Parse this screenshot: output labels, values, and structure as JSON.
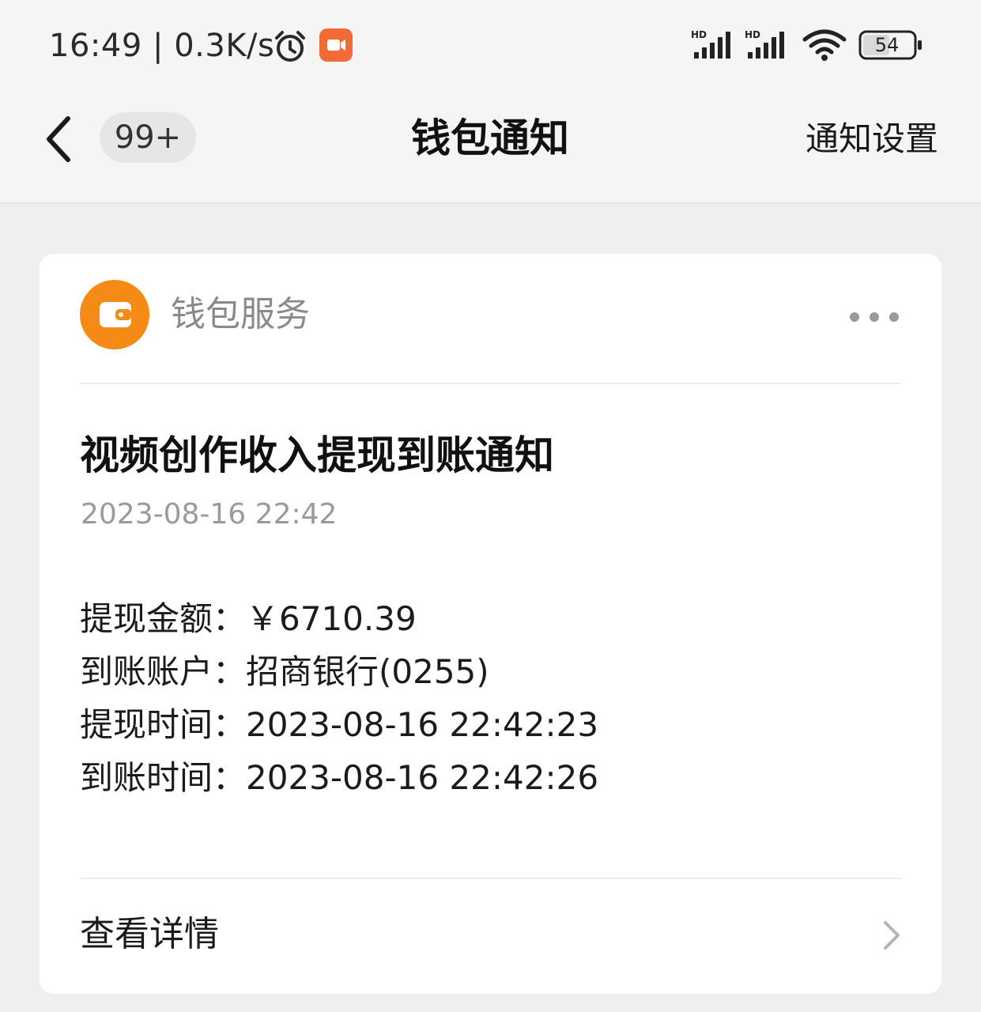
{
  "status_bar": {
    "time": "16:49",
    "separator": "|",
    "network_speed": "0.3K/s",
    "battery": "54",
    "icons": [
      "alarm-icon",
      "screen-record-icon",
      "signal-hd-icon",
      "signal-hd-icon",
      "wifi-icon",
      "battery-icon"
    ]
  },
  "header": {
    "back_icon": "chevron-left-icon",
    "badge_count": "99+",
    "title": "钱包通知",
    "settings_label": "通知设置"
  },
  "card": {
    "service_name": "钱包服务",
    "service_icon": "wallet-icon",
    "accent_color": "#f58a14",
    "more_icon": "more-horizontal-icon",
    "title": "视频创作收入提现到账通知",
    "date": "2023-08-16 22:42",
    "details": [
      {
        "text": "提现金额：￥6710.39"
      },
      {
        "text": "到账账户：招商银行(0255)"
      },
      {
        "text": "提现时间：2023-08-16 22:42:23"
      },
      {
        "text": "到账时间：2023-08-16 22:42:26"
      }
    ],
    "footer_label": "查看详情",
    "footer_icon": "chevron-right-icon"
  }
}
